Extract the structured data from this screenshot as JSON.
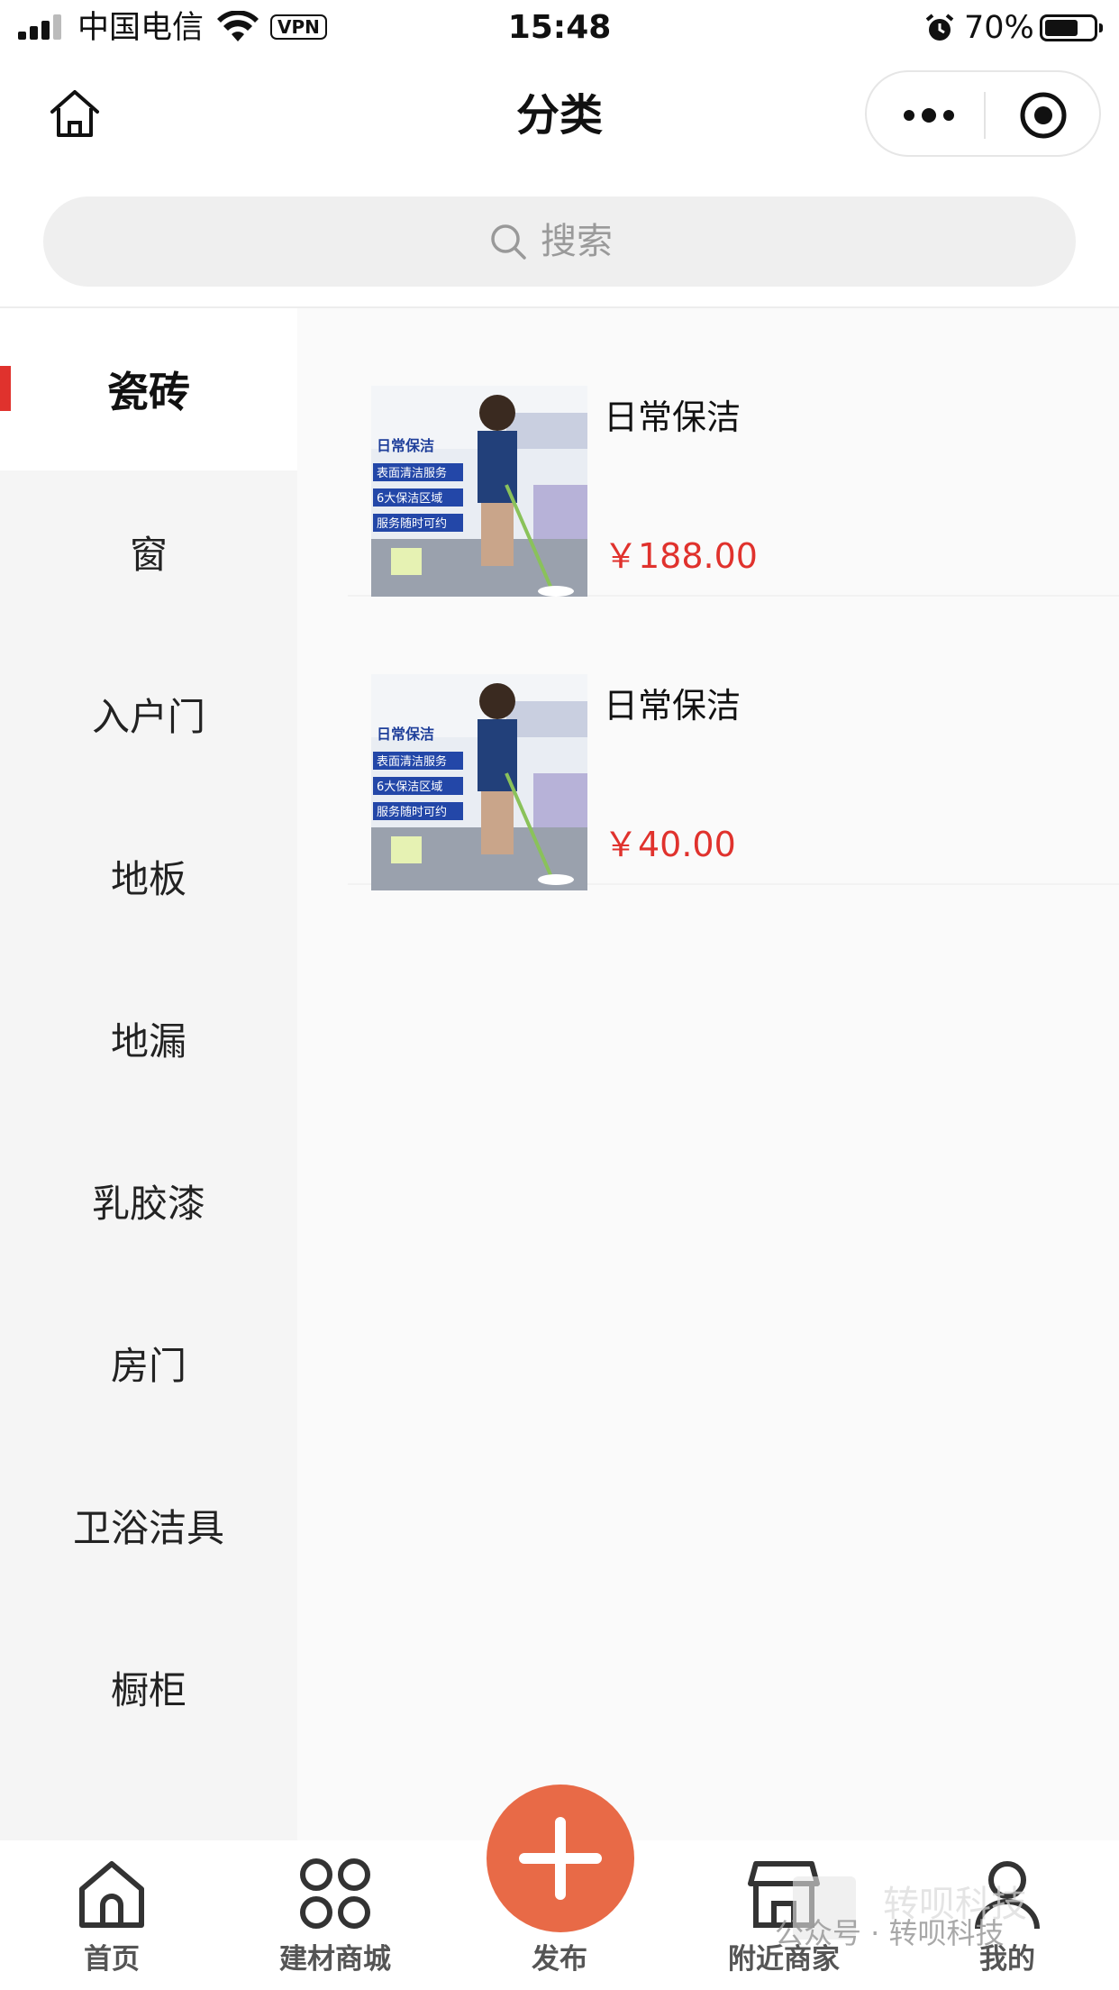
{
  "status_bar": {
    "carrier": "中国电信",
    "vpn": "VPN",
    "time": "15:48",
    "battery_pct": "70%",
    "battery_level": 0.7
  },
  "nav": {
    "title": "分类"
  },
  "search": {
    "placeholder": "搜索"
  },
  "sidebar": {
    "items": [
      {
        "label": "瓷砖",
        "active": true
      },
      {
        "label": "窗"
      },
      {
        "label": "入户门"
      },
      {
        "label": "地板"
      },
      {
        "label": "地漏"
      },
      {
        "label": "乳胶漆"
      },
      {
        "label": "房门"
      },
      {
        "label": "卫浴洁具"
      },
      {
        "label": "橱柜"
      }
    ]
  },
  "products": [
    {
      "name": "日常保洁",
      "price": "￥188.00",
      "thumb": {
        "title": "日常保洁",
        "lines": [
          "表面清洁服务",
          "6大保洁区域",
          "服务随时可约"
        ]
      }
    },
    {
      "name": "日常保洁",
      "price": "￥40.00",
      "thumb": {
        "title": "日常保洁",
        "lines": [
          "表面清洁服务",
          "6大保洁区域",
          "服务随时可约"
        ]
      }
    }
  ],
  "tabbar": {
    "items": [
      {
        "label": "首页",
        "icon": "home-icon"
      },
      {
        "label": "建材商城",
        "icon": "grid-icon"
      },
      {
        "label": "发布",
        "icon": "plus-icon"
      },
      {
        "label": "附近商家",
        "icon": "store-icon"
      },
      {
        "label": "我的",
        "icon": "user-icon"
      }
    ]
  },
  "watermark": {
    "text": "公众号 · 转呗科技",
    "brand": "转呗科技"
  },
  "colors": {
    "accent_red": "#e0322d",
    "publish_orange": "#e86a47",
    "sidebar_bg": "#f5f5f5"
  }
}
